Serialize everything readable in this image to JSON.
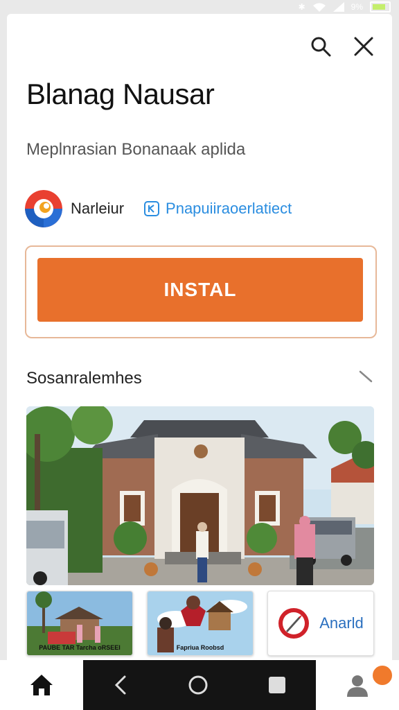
{
  "status_bar": {
    "battery_text": "9%"
  },
  "app": {
    "title": "Blanag Nausar",
    "subtitle": "Meplnrasian Bonanaak aplida",
    "developer": "Narleiur",
    "developer_link": "Pnapuiiraoerlatiect",
    "install_label": "INSTAL"
  },
  "section": {
    "title": "Sosanralemhes"
  },
  "thumbnails": [
    {
      "caption": "PAUBE TAR Tarcha oRSEEI"
    },
    {
      "caption": "Fapriua Roobsd"
    },
    {
      "label": "Anarld"
    }
  ],
  "colors": {
    "accent": "#e8702c",
    "link": "#2a8de0"
  }
}
